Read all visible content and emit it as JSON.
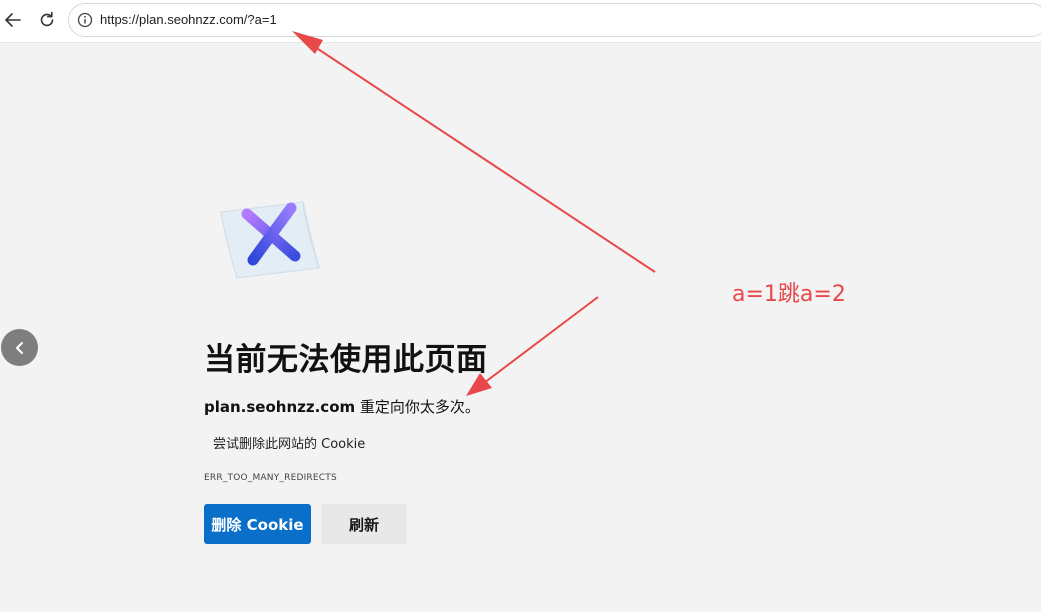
{
  "browser": {
    "url": "https://plan.seohnzz.com/?a=1",
    "icons": {
      "back": "back-arrow-icon",
      "reload": "reload-icon",
      "info": "info-icon"
    }
  },
  "error_page": {
    "title": "当前无法使用此页面",
    "host": "plan.seohnzz.com",
    "message": " 重定向你太多次。",
    "suggestion": "尝试删除此网站的 Cookie",
    "error_code": "ERR_TOO_MANY_REDIRECTS",
    "primary_button": "删除 Cookie",
    "secondary_button": "刷新"
  },
  "annotation": {
    "text": "a=1跳a=2",
    "color": "#e8484a"
  },
  "colors": {
    "primary": "#0a6fc8",
    "background": "#f3f3f3"
  }
}
